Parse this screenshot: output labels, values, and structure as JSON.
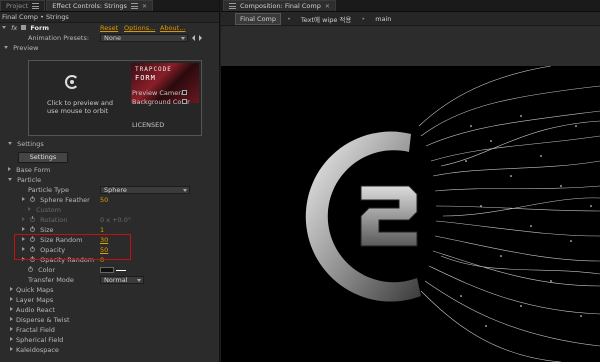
{
  "left_panel": {
    "tabs": [
      {
        "label": "Project"
      },
      {
        "label": "Effect Controls: Strings"
      }
    ],
    "breadcrumb": "Final Comp • Strings",
    "effect": {
      "name": "Form",
      "reset": "Reset",
      "options": "Options...",
      "about": "About...",
      "presets_label": "Animation Presets:",
      "presets_value": "None"
    },
    "preview": {
      "section": "Preview",
      "logo_line1": "TRAPCODE",
      "logo_line2": "FORM",
      "hint": "Click to preview and use mouse to orbit",
      "preview_camera": "Preview Camera",
      "background_color": "Background Color",
      "licensed": "LICENSED"
    },
    "settings": {
      "section": "Settings",
      "button": "Settings"
    },
    "base_form": "Base Form",
    "particle": {
      "section": "Particle",
      "type_label": "Particle Type",
      "type_value": "Sphere",
      "sphere_feather": "Sphere Feather",
      "sphere_feather_val": "50",
      "custom": "Custom",
      "rotation": "Rotation",
      "rotation_val": "0 x +0.0°",
      "size": "Size",
      "size_val": "1",
      "size_random": "Size Random",
      "size_random_val": "30",
      "opacity": "Opacity",
      "opacity_val": "50",
      "opacity_random": "Opacity Random",
      "opacity_random_val": "0",
      "color": "Color",
      "transfer_mode_label": "Transfer Mode",
      "transfer_mode_value": "Normal"
    },
    "groups": [
      "Quick Maps",
      "Layer Maps",
      "Audio React",
      "Disperse & Twist",
      "Fractal Field",
      "Spherical Field",
      "Kaleidospace"
    ],
    "highlight_color": "#c41010"
  },
  "right_panel": {
    "tab": "Composition: Final Comp",
    "subtabs": [
      "Final Comp",
      "Text에 wipe 적용",
      "main"
    ]
  },
  "colors": {
    "accent": "#e0a000",
    "link": "#d89a00",
    "panel": "#2b2b2b"
  }
}
